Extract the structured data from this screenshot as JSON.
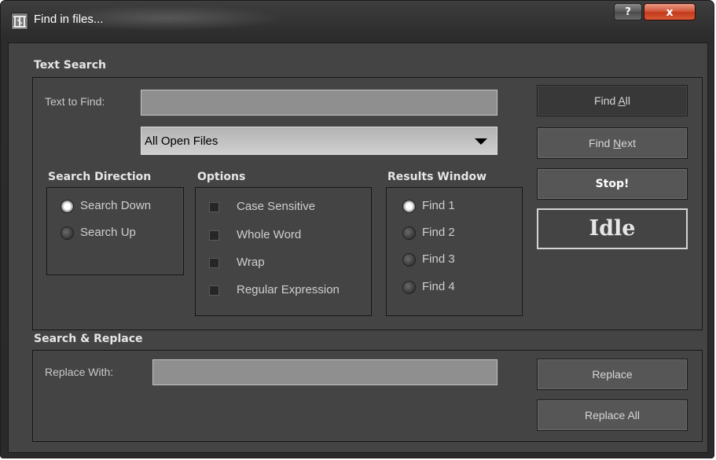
{
  "window": {
    "title": "Find in files...",
    "help_label": "?",
    "close_label": "x"
  },
  "text_search": {
    "group_label": "Text Search",
    "find_label": "Text to Find:",
    "find_value": "",
    "scope_value": "All Open Files"
  },
  "direction": {
    "group_label": "Search Direction",
    "items": [
      {
        "label": "Search Down",
        "selected": true
      },
      {
        "label": "Search Up",
        "selected": false
      }
    ]
  },
  "options": {
    "group_label": "Options",
    "items": [
      {
        "label": "Case Sensitive",
        "checked": false
      },
      {
        "label": "Whole Word",
        "checked": false
      },
      {
        "label": "Wrap",
        "checked": false
      },
      {
        "label": "Regular Expression",
        "checked": false
      }
    ]
  },
  "results_window": {
    "group_label": "Results Window",
    "items": [
      {
        "label": "Find 1",
        "selected": true
      },
      {
        "label": "Find 2",
        "selected": false
      },
      {
        "label": "Find 3",
        "selected": false
      },
      {
        "label": "Find 4",
        "selected": false
      }
    ]
  },
  "buttons": {
    "find_all_pre": "Find ",
    "find_all_ul": "A",
    "find_all_post": "ll",
    "find_next_pre": "Find ",
    "find_next_ul": "N",
    "find_next_post": "ext",
    "stop": "Stop!"
  },
  "status": "Idle",
  "replace": {
    "group_label": "Search & Replace",
    "replace_label": "Replace With:",
    "replace_value": "",
    "replace_button": "Replace",
    "replace_all_button": "Replace All"
  }
}
